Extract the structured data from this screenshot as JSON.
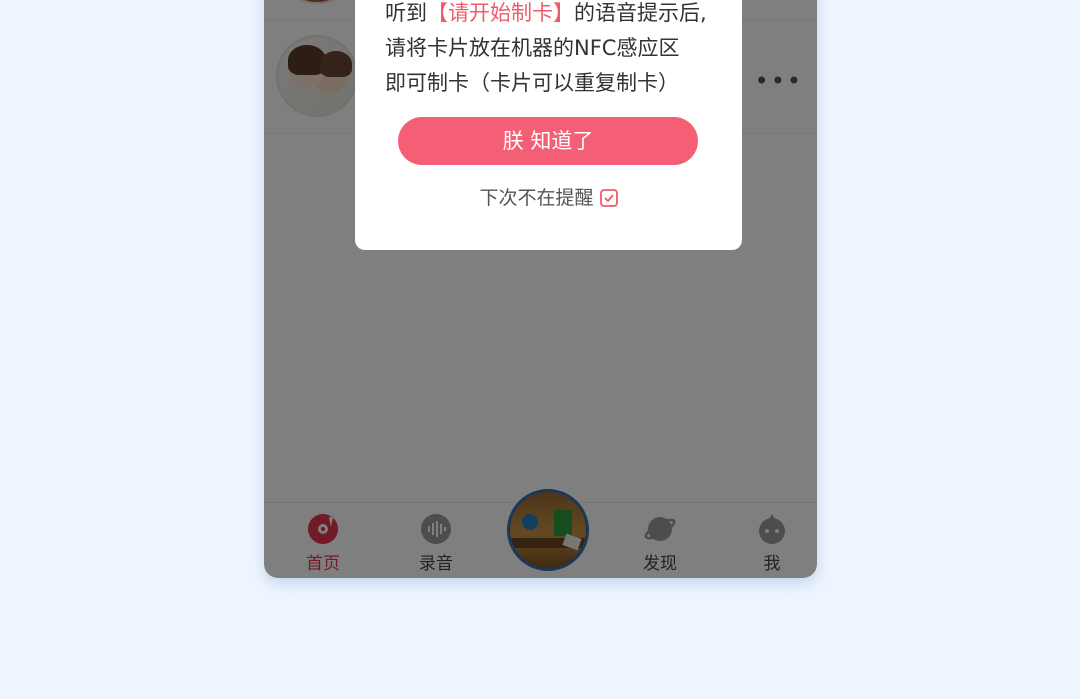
{
  "dialog": {
    "line1_prefix": "听到",
    "line1_highlight": "【请开始制卡】",
    "line1_suffix": "的语音提示后,",
    "line2": "请将卡片放在机器的NFC感应区",
    "line3": "即可制卡（卡片可以重复制卡）",
    "confirm_label": "朕 知道了",
    "dont_remind_label": "下次不在提醒"
  },
  "tabbar": {
    "items": [
      {
        "label": "首页",
        "icon": "record-disc-icon",
        "active": true
      },
      {
        "label": "录音",
        "icon": "sound-wave-icon",
        "active": false
      },
      {
        "label": "",
        "icon": "center-photo",
        "active": false
      },
      {
        "label": "发现",
        "icon": "planet-icon",
        "active": false
      },
      {
        "label": "我",
        "icon": "profile-icon",
        "active": false
      }
    ]
  },
  "list": {
    "more_label": "•••"
  },
  "colors": {
    "accent": "#f55f75",
    "highlight_text": "#f05b6c",
    "active_tab": "#e6354e",
    "page_background": "#eef5ff"
  }
}
